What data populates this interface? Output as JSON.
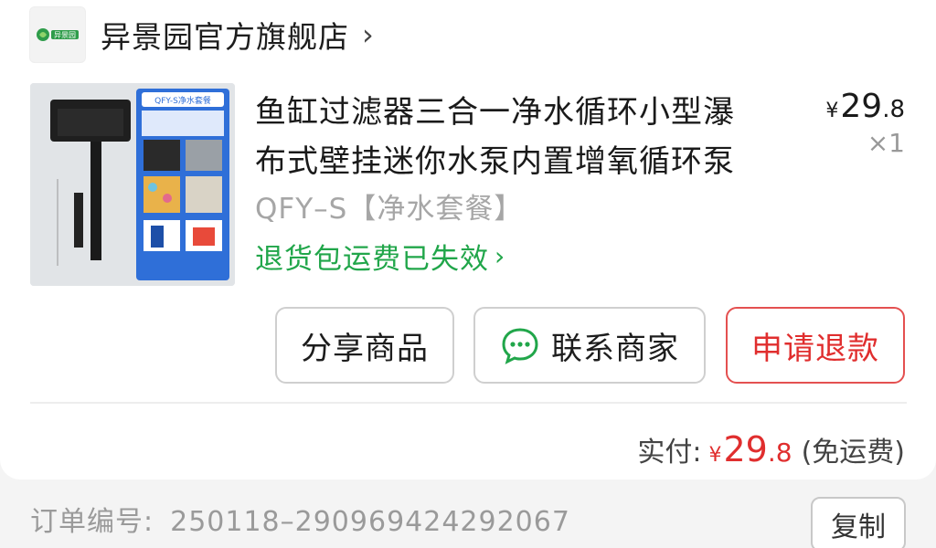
{
  "store": {
    "name": "异景园官方旗舰店",
    "chevron": "›",
    "logo_text": "异景园"
  },
  "product": {
    "title_line1": "鱼缸过滤器三合一净水循环小型瀑",
    "title_line2": "布式壁挂迷你水泵内置增氧循环泵",
    "price_symbol": "¥",
    "price_int": "29",
    "price_dec": ".8",
    "quantity": "×1",
    "variant": "QFY–S【净水套餐】",
    "return_note": "退货包运费已失效",
    "return_chevron": "›",
    "thumb_label": "QFY-S净水套餐"
  },
  "actions": {
    "share": "分享商品",
    "contact": "联系商家",
    "refund": "申请退款"
  },
  "payment": {
    "label": "实付:",
    "symbol": "¥",
    "int": "29",
    "dec": ".8",
    "shipping": "(免运费)"
  },
  "order": {
    "label": "订单编号:",
    "number": "250118–290969424292067",
    "copy": "复制"
  },
  "colors": {
    "accent_red": "#e02e2e",
    "green": "#21a64a"
  }
}
